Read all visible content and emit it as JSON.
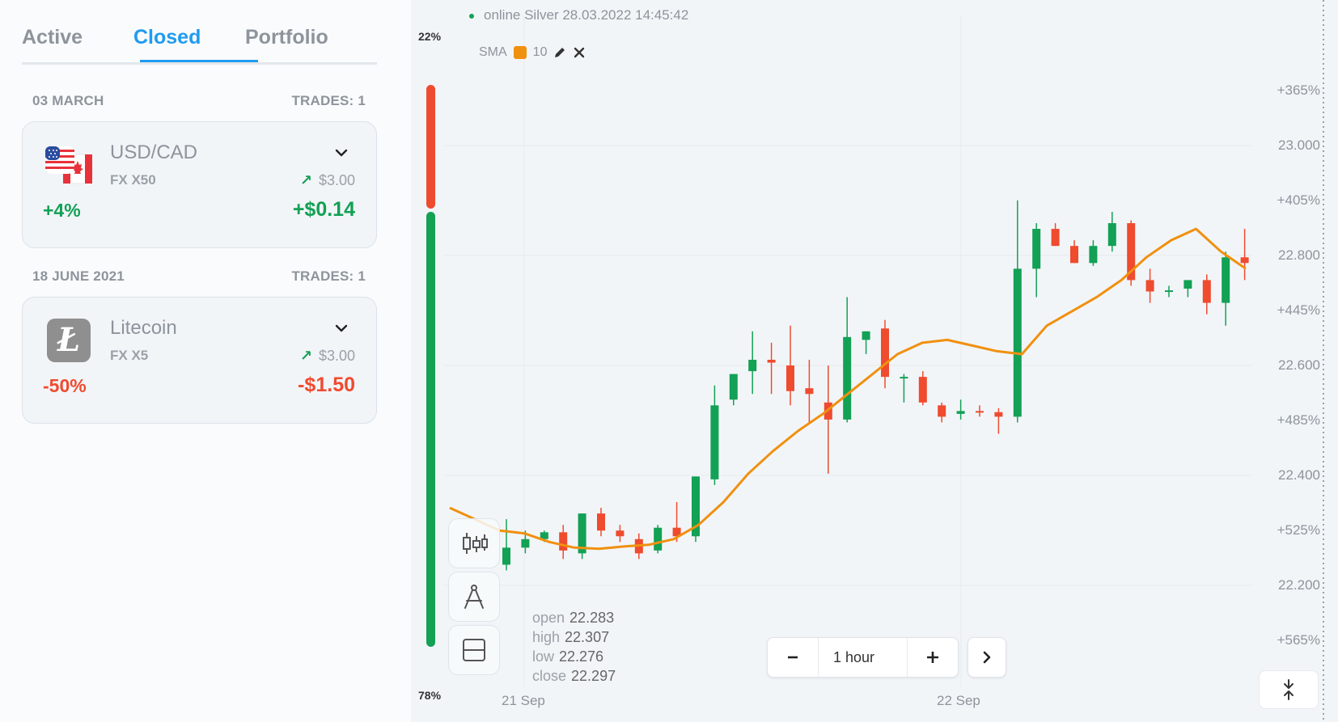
{
  "tabs": [
    {
      "label": "Active",
      "active": false
    },
    {
      "label": "Closed",
      "active": true
    },
    {
      "label": "Portfolio",
      "active": false
    }
  ],
  "groups": [
    {
      "date": "03 MARCH",
      "trades": "TRADES: 1",
      "asset": "USD/CAD",
      "multiplier": "FX X50",
      "invest": "$3.00",
      "percent": "+4%",
      "pnl": "+$0.14",
      "direction": "profit",
      "icon": "us-ca-flag-icon"
    },
    {
      "date": "18 JUNE 2021",
      "trades": "TRADES: 1",
      "asset": "Litecoin",
      "multiplier": "FX X5",
      "invest": "$3.00",
      "percent": "-50%",
      "pnl": "-$1.50",
      "direction": "loss",
      "icon": "litecoin-icon"
    }
  ],
  "chart": {
    "status": "online Silver  28.03.2022 14:45:42",
    "indicator": {
      "name": "SMA",
      "period": "10",
      "color": "#f0900f"
    },
    "sentiment": {
      "top": "22%",
      "bottom": "78%"
    },
    "ohlc": [
      {
        "label": "open",
        "value": "22.283"
      },
      {
        "label": "high",
        "value": "22.307"
      },
      {
        "label": "low",
        "value": "22.276"
      },
      {
        "label": "close",
        "value": "22.297"
      }
    ],
    "timeframe": "1 hour",
    "x_labels": [
      "21 Sep",
      "22 Sep"
    ],
    "y_labels": [
      "+365%",
      "23.000",
      "+405%",
      "22.800",
      "+445%",
      "22.600",
      "+485%",
      "22.400",
      "+525%",
      "22.200",
      "+565%"
    ],
    "colors": {
      "up": "#12a155",
      "down": "#ef4b2f",
      "sma": "#f0900f"
    }
  },
  "chart_data": {
    "type": "candlestick",
    "ylim": [
      22.1,
      23.08
    ],
    "candles": [
      {
        "o": 22.23,
        "h": 22.31,
        "l": 22.22,
        "c": 22.26
      },
      {
        "o": 22.26,
        "h": 22.29,
        "l": 22.25,
        "c": 22.275
      },
      {
        "o": 22.275,
        "h": 22.29,
        "l": 22.27,
        "c": 22.287
      },
      {
        "o": 22.287,
        "h": 22.3,
        "l": 22.24,
        "c": 22.255
      },
      {
        "o": 22.25,
        "h": 22.32,
        "l": 22.24,
        "c": 22.32
      },
      {
        "o": 22.32,
        "h": 22.33,
        "l": 22.28,
        "c": 22.29
      },
      {
        "o": 22.29,
        "h": 22.3,
        "l": 22.27,
        "c": 22.28
      },
      {
        "o": 22.275,
        "h": 22.285,
        "l": 22.24,
        "c": 22.25
      },
      {
        "o": 22.255,
        "h": 22.3,
        "l": 22.25,
        "c": 22.295
      },
      {
        "o": 22.295,
        "h": 22.34,
        "l": 22.27,
        "c": 22.28
      },
      {
        "o": 22.28,
        "h": 22.385,
        "l": 22.27,
        "c": 22.385
      },
      {
        "o": 22.38,
        "h": 22.545,
        "l": 22.37,
        "c": 22.51
      },
      {
        "o": 22.52,
        "h": 22.565,
        "l": 22.51,
        "c": 22.565
      },
      {
        "o": 22.57,
        "h": 22.64,
        "l": 22.53,
        "c": 22.59
      },
      {
        "o": 22.59,
        "h": 22.62,
        "l": 22.53,
        "c": 22.585
      },
      {
        "o": 22.58,
        "h": 22.65,
        "l": 22.51,
        "c": 22.535
      },
      {
        "o": 22.54,
        "h": 22.59,
        "l": 22.48,
        "c": 22.53
      },
      {
        "o": 22.515,
        "h": 22.58,
        "l": 22.39,
        "c": 22.485
      },
      {
        "o": 22.485,
        "h": 22.7,
        "l": 22.48,
        "c": 22.63
      },
      {
        "o": 22.625,
        "h": 22.64,
        "l": 22.6,
        "c": 22.64
      },
      {
        "o": 22.645,
        "h": 22.66,
        "l": 22.54,
        "c": 22.56
      },
      {
        "o": 22.56,
        "h": 22.565,
        "l": 22.515,
        "c": 22.56
      },
      {
        "o": 22.56,
        "h": 22.57,
        "l": 22.51,
        "c": 22.515
      },
      {
        "o": 22.51,
        "h": 22.515,
        "l": 22.48,
        "c": 22.49
      },
      {
        "o": 22.495,
        "h": 22.52,
        "l": 22.485,
        "c": 22.5
      },
      {
        "o": 22.5,
        "h": 22.51,
        "l": 22.49,
        "c": 22.498
      },
      {
        "o": 22.498,
        "h": 22.505,
        "l": 22.46,
        "c": 22.49
      },
      {
        "o": 22.49,
        "h": 22.87,
        "l": 22.48,
        "c": 22.75
      },
      {
        "o": 22.75,
        "h": 22.83,
        "l": 22.7,
        "c": 22.82
      },
      {
        "o": 22.82,
        "h": 22.83,
        "l": 22.79,
        "c": 22.79
      },
      {
        "o": 22.79,
        "h": 22.8,
        "l": 22.76,
        "c": 22.76
      },
      {
        "o": 22.76,
        "h": 22.8,
        "l": 22.755,
        "c": 22.79
      },
      {
        "o": 22.79,
        "h": 22.85,
        "l": 22.78,
        "c": 22.83
      },
      {
        "o": 22.83,
        "h": 22.835,
        "l": 22.72,
        "c": 22.73
      },
      {
        "o": 22.73,
        "h": 22.75,
        "l": 22.69,
        "c": 22.71
      },
      {
        "o": 22.71,
        "h": 22.72,
        "l": 22.7,
        "c": 22.712
      },
      {
        "o": 22.715,
        "h": 22.73,
        "l": 22.7,
        "c": 22.73
      },
      {
        "o": 22.73,
        "h": 22.74,
        "l": 22.67,
        "c": 22.69
      },
      {
        "o": 22.69,
        "h": 22.78,
        "l": 22.65,
        "c": 22.77
      },
      {
        "o": 22.77,
        "h": 22.82,
        "l": 22.73,
        "c": 22.76
      }
    ],
    "sma": [
      22.33,
      22.31,
      22.29,
      22.285,
      22.27,
      22.26,
      22.258,
      22.262,
      22.265,
      22.275,
      22.3,
      22.34,
      22.39,
      22.43,
      22.465,
      22.495,
      22.53,
      22.565,
      22.6,
      22.62,
      22.625,
      22.615,
      22.605,
      22.6,
      22.65,
      22.675,
      22.7,
      22.73,
      22.77,
      22.8,
      22.82,
      22.78,
      22.75
    ]
  }
}
